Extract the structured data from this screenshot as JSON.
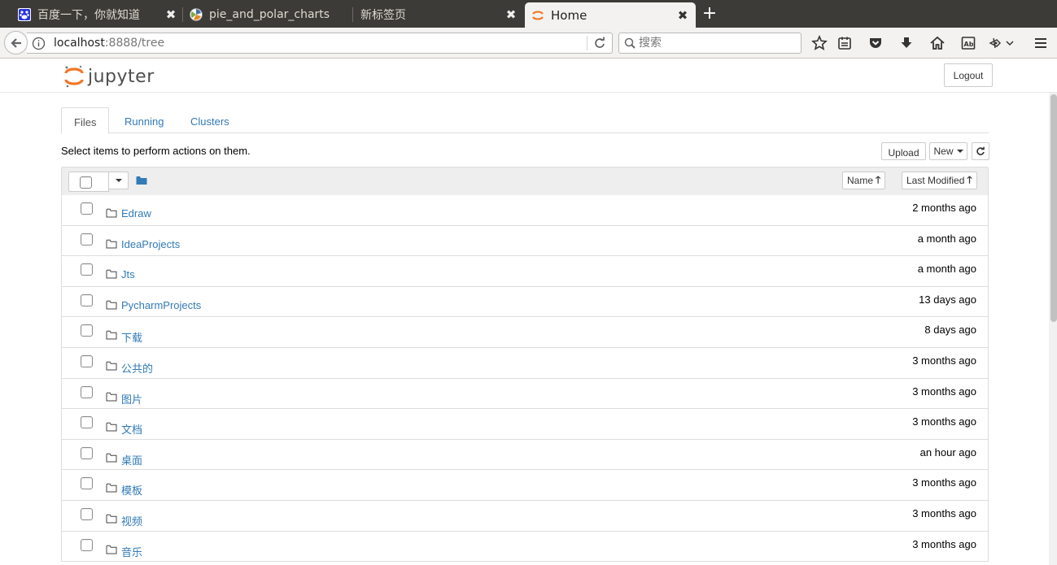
{
  "browser": {
    "tabs": [
      {
        "title": "百度一下，你就知道",
        "icon": "baidu-paw-icon"
      },
      {
        "title": "pie_and_polar_charts",
        "icon": "matplotlib-icon"
      },
      {
        "title": "新标签页",
        "icon": ""
      },
      {
        "title": "Home",
        "icon": "jupyter-icon"
      }
    ],
    "url_host": "localhost",
    "url_path": ":8888/tree",
    "search_placeholder": "搜索"
  },
  "header": {
    "logo_text": "jupyter",
    "logout_label": "Logout"
  },
  "tabs": [
    {
      "label": "Files"
    },
    {
      "label": "Running"
    },
    {
      "label": "Clusters"
    }
  ],
  "toolbar": {
    "hint": "Select items to perform actions on them.",
    "upload_label": "Upload",
    "new_label": "New"
  },
  "list_header": {
    "name_label": "Name",
    "modified_label": "Last Modified"
  },
  "files": [
    {
      "name": "Edraw",
      "modified": "2 months ago"
    },
    {
      "name": "IdeaProjects",
      "modified": "a month ago"
    },
    {
      "name": "Jts",
      "modified": "a month ago"
    },
    {
      "name": "PycharmProjects",
      "modified": "13 days ago"
    },
    {
      "name": "下载",
      "modified": "8 days ago"
    },
    {
      "name": "公共的",
      "modified": "3 months ago"
    },
    {
      "name": "图片",
      "modified": "3 months ago"
    },
    {
      "name": "文档",
      "modified": "3 months ago"
    },
    {
      "name": "桌面",
      "modified": "an hour ago"
    },
    {
      "name": "模板",
      "modified": "3 months ago"
    },
    {
      "name": "视频",
      "modified": "3 months ago"
    },
    {
      "name": "音乐",
      "modified": "3 months ago"
    }
  ],
  "colors": {
    "link": "#337ab7",
    "jupyter_orange": "#f37726",
    "tabstrip": "#3c3b37"
  }
}
